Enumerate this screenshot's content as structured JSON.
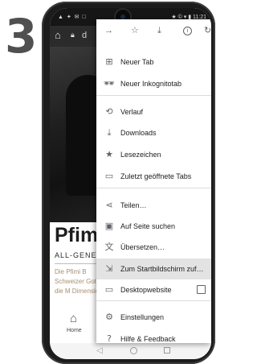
{
  "step_number": "3",
  "status_bar": {
    "left": "▲ ✦ ✉ □",
    "right": "★ © ▾ ▮ 11:21"
  },
  "browser": {
    "url_text": "d"
  },
  "page": {
    "title": "Pfimi",
    "subtitle": "ALL-GENE",
    "description": "Die Pfimi B Schweizer Gott, die M Dimension",
    "bottom_nav": {
      "home_label": "Home"
    }
  },
  "menu": {
    "items": [
      {
        "icon": "plus-box-icon",
        "label": "Neuer Tab"
      },
      {
        "icon": "incognito-icon",
        "label": "Neuer Inkognitotab"
      },
      {
        "icon": "history-icon",
        "label": "Verlauf"
      },
      {
        "icon": "download-icon",
        "label": "Downloads"
      },
      {
        "icon": "star-icon",
        "label": "Lesezeichen"
      },
      {
        "icon": "recent-tabs-icon",
        "label": "Zuletzt geöffnete Tabs"
      },
      {
        "icon": "share-icon",
        "label": "Teilen…"
      },
      {
        "icon": "find-in-page-icon",
        "label": "Auf Seite suchen"
      },
      {
        "icon": "translate-icon",
        "label": "Übersetzen…"
      },
      {
        "icon": "add-to-home-icon",
        "label": "Zum Startbildschirm zuf…"
      },
      {
        "icon": "desktop-icon",
        "label": "Desktopwebsite"
      },
      {
        "icon": "settings-icon",
        "label": "Einstellungen"
      },
      {
        "icon": "help-icon",
        "label": "Hilfe & Feedback"
      }
    ],
    "highlighted_index": 9,
    "desktop_site_checked": false
  },
  "colors": {
    "step_number": "#505050",
    "highlight": "#e3e3e3",
    "icon": "#5f6368"
  }
}
